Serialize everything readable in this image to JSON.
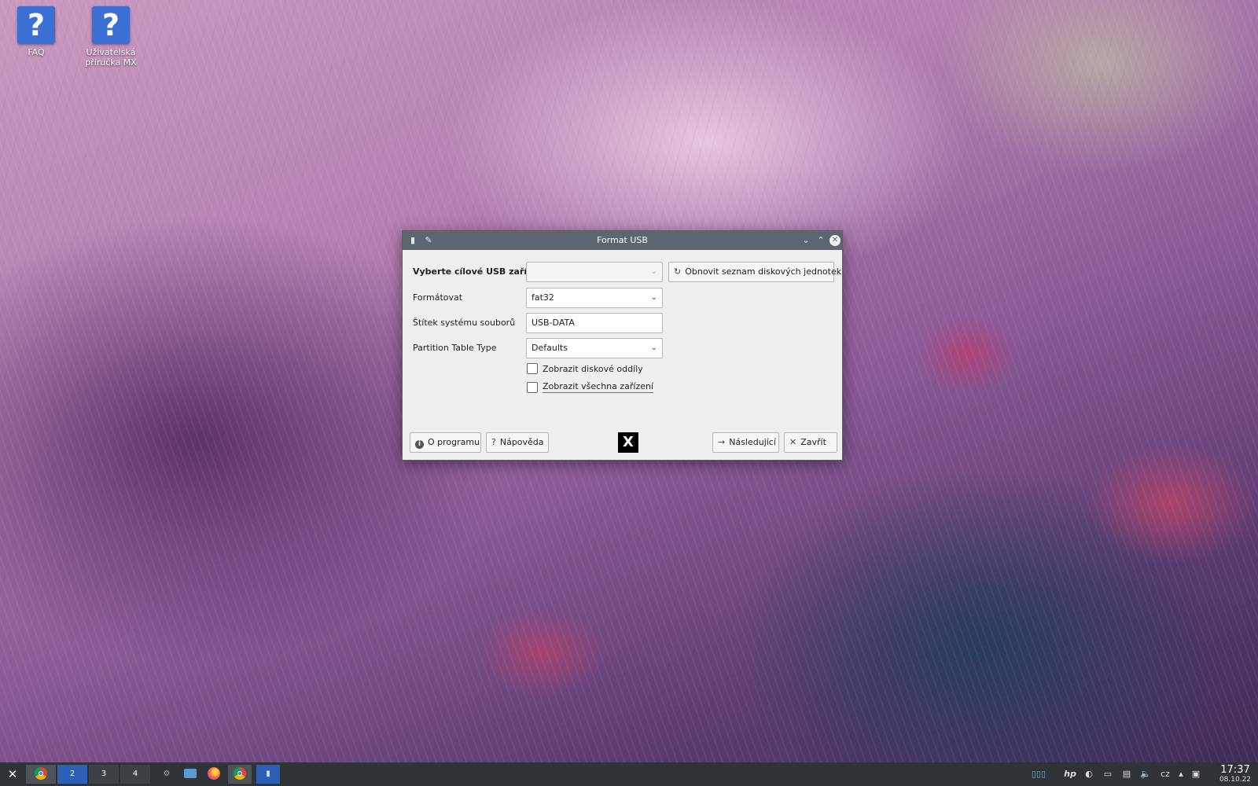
{
  "desktop": {
    "icons": [
      {
        "label": "FAQ",
        "glyph": "?"
      },
      {
        "label_line1": "Uživatelská",
        "label_line2": "příručka MX",
        "glyph": "?"
      }
    ]
  },
  "dialog": {
    "title": "Format USB",
    "fields": {
      "target_label": "Vyberte cílové USB zařízení",
      "target_value": "",
      "refresh_button": "Obnovit seznam diskových jednotek",
      "format_label": "Formátovat",
      "format_value": "fat32",
      "fs_label_label": "Štítek systému souborů",
      "fs_label_value": "USB-DATA",
      "partition_label": "Partition Table Type",
      "partition_value": "Defaults"
    },
    "checkboxes": {
      "show_partitions": {
        "label": "Zobrazit diskové oddíly",
        "checked": false
      },
      "show_all": {
        "label": "Zobrazit všechna zařízení",
        "checked": false
      }
    },
    "buttons": {
      "about": "O programu",
      "help": "Nápověda",
      "next": "Následující",
      "close": "Zavřít"
    }
  },
  "taskbar": {
    "workspaces": [
      "2",
      "3",
      "4"
    ],
    "keyboard_layout": "cz",
    "time": "17:37",
    "date": "08.10.22"
  },
  "colors": {
    "titlebar": "#5b6670",
    "taskbar": "#2f3338",
    "accent": "#3b7dd8",
    "desktop_icon": "#3b6fd4"
  }
}
